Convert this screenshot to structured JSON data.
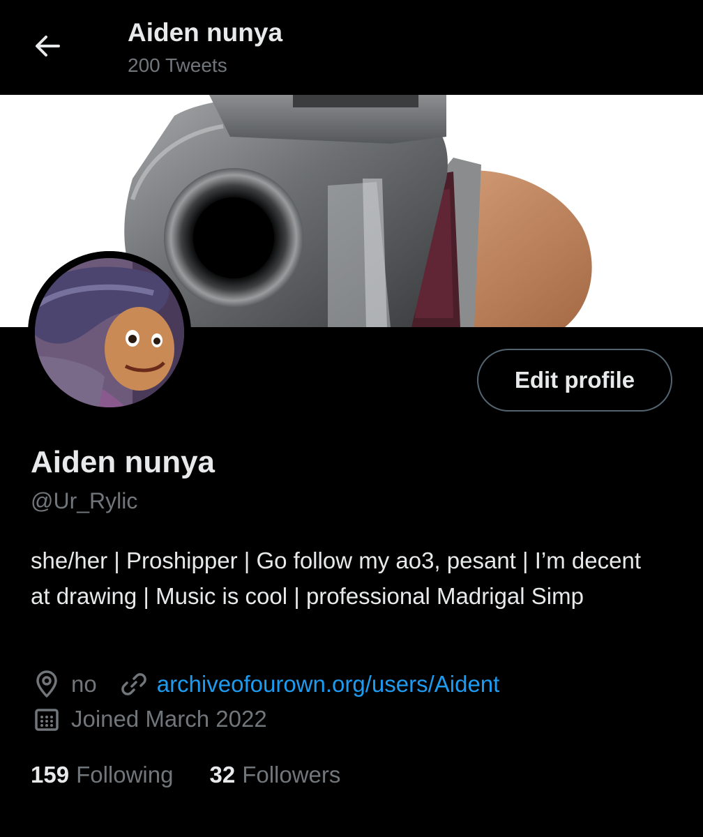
{
  "header": {
    "title": "Aiden nunya",
    "subtitle": "200 Tweets"
  },
  "icons": {
    "back": "arrow-left-icon",
    "location": "location-pin-icon",
    "link": "link-icon",
    "joined": "calendar-icon"
  },
  "profile": {
    "display_name": "Aiden nunya",
    "handle": "@Ur_Rylic",
    "bio": "she/her | Proshipper | Go follow my ao3, pesant | I’m decent at drawing | Music is cool | professional Madrigal Simp",
    "location": "no",
    "website": "archiveofourown.org/users/Aident",
    "joined": "Joined March 2022",
    "following_count": "159",
    "following_label": "Following",
    "followers_count": "32",
    "followers_label": "Followers"
  },
  "buttons": {
    "edit_profile": "Edit profile"
  },
  "colors": {
    "background": "#000000",
    "text_primary": "#e7e9ea",
    "text_secondary": "#71767b",
    "link": "#1d9bf0",
    "button_border": "#536471"
  }
}
